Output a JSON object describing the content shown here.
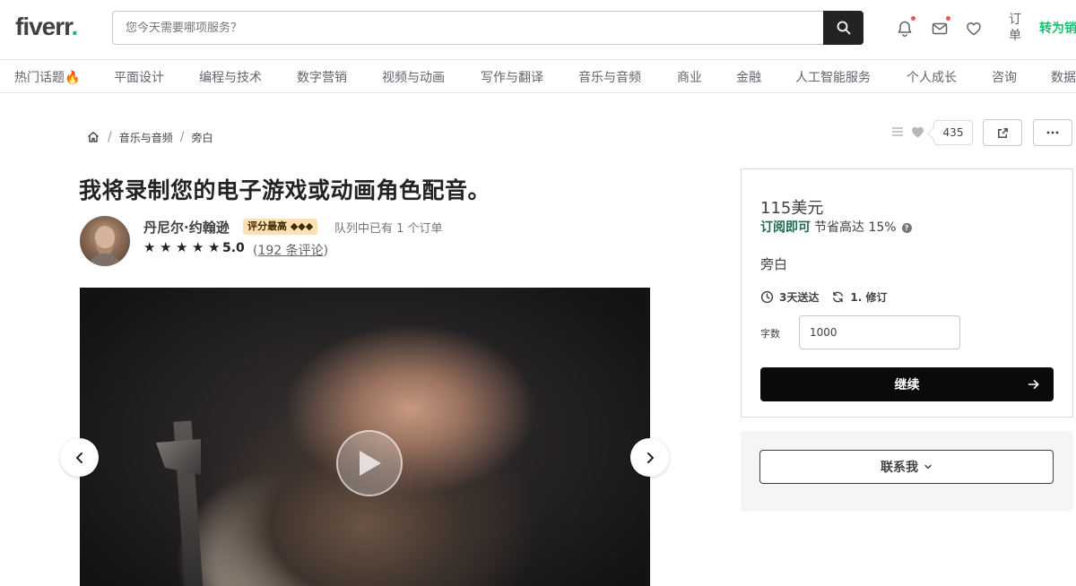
{
  "header": {
    "logo_text": "fiverr",
    "logo_dot": ".",
    "search_placeholder": "您今天需要哪项服务？",
    "orders_label": "订单",
    "switch_label": "转为销"
  },
  "categories": [
    "热门话题🔥",
    "平面设计",
    "编程与技术",
    "数字营销",
    "视频与动画",
    "写作与翻译",
    "音乐与音频",
    "商业",
    "金融",
    "人工智能服务",
    "个人成长",
    "咨询",
    "数据"
  ],
  "breadcrumb": {
    "items": [
      "音乐与音频",
      "旁白"
    ],
    "separator": "/"
  },
  "actions": {
    "like_count": "435"
  },
  "gig": {
    "title": "我将录制您的电子游戏或动画角色配音。"
  },
  "seller": {
    "name": "丹尼尔·约翰逊",
    "badge": "评分最高 ◆◆◆",
    "queue": "队列中已有 1 个订单",
    "rating": "5.0",
    "review_count_open": "(",
    "review_count": "192 条评论",
    "review_count_close": ")",
    "stars": 5
  },
  "pricing": {
    "price": "115美元",
    "subscribe_label": "订阅即可",
    "save_label": "节省高达 15%",
    "package_name": "旁白",
    "delivery": "3天送达",
    "revisions": "1. 修订",
    "word_count_label": "字数",
    "word_count_value": "1000",
    "continue_label": "继续"
  },
  "contact": {
    "label": "联系我"
  },
  "colors": {
    "brand_green": "#1dbf73",
    "subscribe_green": "#1f6b4e",
    "badge_bg": "#ffe0b3",
    "button_black": "#0a0a0a"
  },
  "icons": {
    "search": "search-icon",
    "notifications": "bell-icon",
    "messages": "envelope-icon",
    "favorites": "heart-icon",
    "home": "home-icon",
    "share": "share-icon",
    "more": "more-icon",
    "play": "play-icon",
    "prev": "chevron-left-icon",
    "next": "chevron-right-icon",
    "clock": "clock-icon",
    "revisions": "refresh-icon",
    "arrow": "arrow-right-icon",
    "dropdown": "chevron-down-icon"
  }
}
